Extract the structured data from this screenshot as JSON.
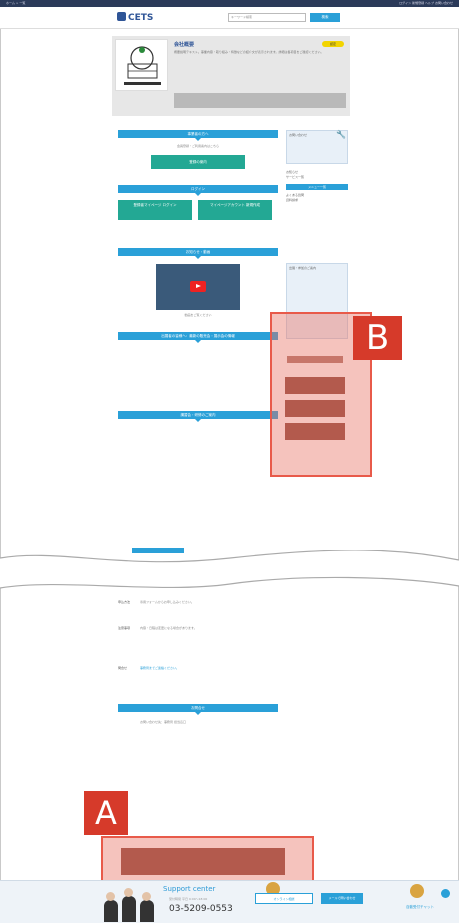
{
  "topbar": {
    "left": "ホーム > 一覧",
    "right": "ログイン 新規登録 ヘルプ お問い合わせ"
  },
  "header": {
    "logo": "CETS",
    "search_placeholder": "キーワード検索",
    "search_button": "検索"
  },
  "profile": {
    "title": "会社概要",
    "badge": "認定",
    "desc": "概要説明テキスト。事業内容・取り組み・特徴などの紹介文が表示されます。詳細は各項目をご確認ください。"
  },
  "main": {
    "sec1": "事業者の方へ",
    "sec1_txt": "会員登録・ご利用案内はこちら",
    "sec1_btn": "登録の案内",
    "sec2": "ログイン",
    "login_btn": "登録者マイページ ログイン",
    "create_btn": "マイページアカウント 新規作成",
    "sec3": "お知らせ・動画",
    "video_caption": "動画をご覧ください",
    "sec4": "出展者の皆様へ：最新の販売会・展示会の情報",
    "sec5": "講習会・研修のご案内"
  },
  "sidebar": {
    "box1": "お問い合わせ",
    "links": [
      "お知らせ",
      "サービス一覧",
      "よくある質問",
      "資料請求"
    ],
    "side_head": "メニュー一覧",
    "box2": "出展・参加のご案内"
  },
  "lower": {
    "rows": [
      {
        "k": "申込方法",
        "v": "専用フォームからお申し込みください。"
      },
      {
        "k": "注意事項",
        "v": "内容・日程は変更になる場合があります。"
      },
      {
        "k": "問合せ",
        "v": "事務局までご連絡ください。"
      }
    ],
    "bar": "お問合せ",
    "contact": "お問い合わせ先：事務局 担当窓口"
  },
  "labels": {
    "a": "A",
    "b": "B"
  },
  "footer": {
    "support_title": "Support center",
    "support_sub": "受付時間 平日 9:00〜18:00",
    "phone": "03-5209-0553",
    "btn1": "オンライン相談",
    "btn2": "メールで問い合わせ",
    "chat": "自動受付チャット"
  }
}
